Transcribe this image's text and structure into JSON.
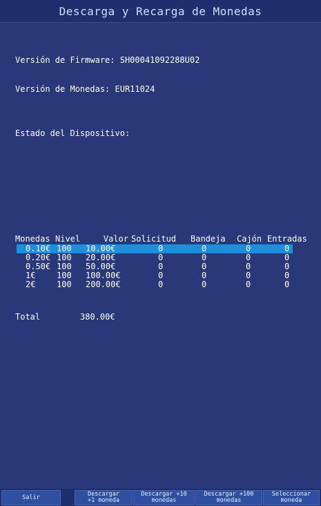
{
  "title": "Descarga y Recarga de Monedas",
  "info": {
    "firmware_line": "Versión de Firmware: SH00041092288U02",
    "coins_line": "Versión de Monedas: EUR11024"
  },
  "estado": "Estado del Dispositivo:",
  "table": {
    "headers": [
      "Monedas",
      "Nivel",
      "Valor",
      "Solicitud",
      "Bandeja",
      "Cajón",
      "Entradas"
    ],
    "rows": [
      {
        "moneda": "0.10€",
        "nivel": "100",
        "valor": "10.00€",
        "solicitud": "0",
        "bandeja": "0",
        "cajon": "0",
        "entradas": "0"
      },
      {
        "moneda": "0.20€",
        "nivel": "100",
        "valor": "20.00€",
        "solicitud": "0",
        "bandeja": "0",
        "cajon": "0",
        "entradas": "0"
      },
      {
        "moneda": "0.50€",
        "nivel": "100",
        "valor": "50.00€",
        "solicitud": "0",
        "bandeja": "0",
        "cajon": "0",
        "entradas": "0"
      },
      {
        "moneda": "1€",
        "nivel": "100",
        "valor": "100.00€",
        "solicitud": "0",
        "bandeja": "0",
        "cajon": "0",
        "entradas": "0"
      },
      {
        "moneda": "2€",
        "nivel": "100",
        "valor": "200.00€",
        "solicitud": "0",
        "bandeja": "0",
        "cajon": "0",
        "entradas": "0"
      }
    ]
  },
  "total": {
    "label": "Total",
    "value": "380.00€"
  },
  "footer": {
    "salir": "Salir",
    "descargar1": [
      "Descargar",
      "+1 moneda"
    ],
    "descargar10": [
      "Descargar +10",
      "monedas"
    ],
    "descargar100": [
      "Descargar +100",
      "monedas"
    ],
    "seleccionar": [
      "Seleccionar",
      "moneda"
    ]
  },
  "colors": {
    "background": "#283878",
    "selected_row": "#1e90d9",
    "footer": "#1f2f6e"
  }
}
